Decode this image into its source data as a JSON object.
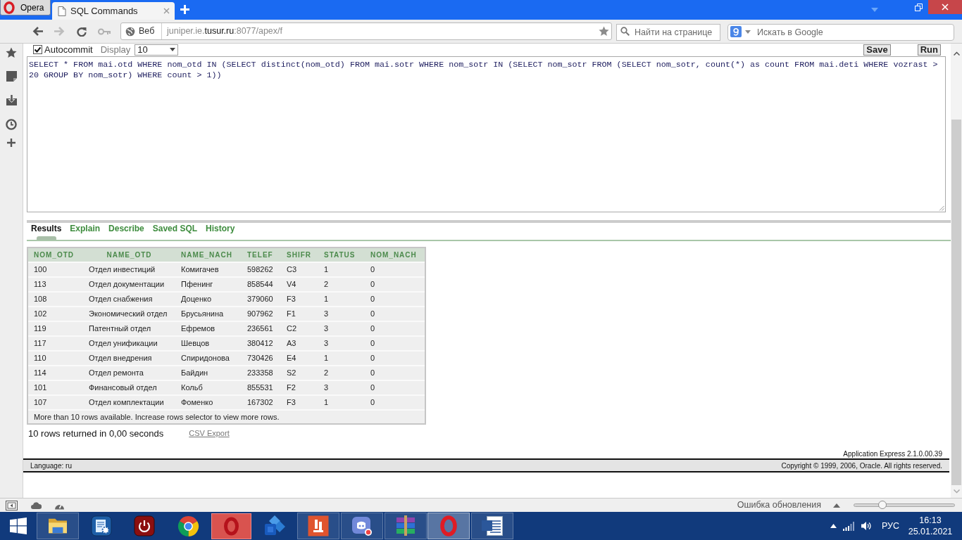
{
  "browser": {
    "menu_button": "Opera",
    "tabs": [
      {
        "title": "SQL Commands",
        "selected": true
      }
    ],
    "navigation": {
      "back": {
        "disabled": false
      },
      "forward": {
        "disabled": true
      }
    },
    "address_bar": {
      "badge": "Веб",
      "url": {
        "subdomain": "juniper.ie.",
        "domain": "tusur.ru",
        "path": ":8077/apex/f"
      }
    },
    "find_field": {
      "placeholder": "Найти на странице"
    },
    "search_field": {
      "placeholder": "Искать в Google"
    }
  },
  "sql_workshop": {
    "autocommit": {
      "label": "Autocommit",
      "checked": true
    },
    "display": {
      "label": "Display",
      "value": "10"
    },
    "buttons": [
      "Save",
      "Run"
    ],
    "query": "SELECT * FROM mai.otd WHERE nom_otd IN (SELECT distinct(nom_otd) FROM mai.sotr WHERE nom_sotr IN (SELECT nom_sotr FROM (SELECT nom_sotr, count(*) as count FROM mai.deti WHERE vozrast > 20 GROUP BY nom_sotr) WHERE count > 1))",
    "tabs": [
      {
        "label": "Results",
        "selected": true
      },
      {
        "label": "Explain",
        "selected": false
      },
      {
        "label": "Describe",
        "selected": false
      },
      {
        "label": "Saved SQL",
        "selected": false
      },
      {
        "label": "History",
        "selected": false
      }
    ],
    "results": {
      "columns": [
        "NOM_OTD",
        "NAME_OTD",
        "NAME_NACH",
        "TELEF",
        "SHIFR",
        "STATUS",
        "NOM_NACH"
      ],
      "rows": [
        [
          "100",
          "Отдел инвестиций",
          "Комигачев",
          "598262",
          "C3",
          "1",
          "0"
        ],
        [
          "113",
          "Отдел документации",
          "Пфенинг",
          "858544",
          "V4",
          "2",
          "0"
        ],
        [
          "108",
          "Отдел снабжения",
          "Доценко",
          "379060",
          "F3",
          "1",
          "0"
        ],
        [
          "102",
          "Экономический отдел",
          "Брусьянина",
          "907962",
          "F1",
          "3",
          "0"
        ],
        [
          "119",
          "Патентный отдел",
          "Ефремов",
          "236561",
          "C2",
          "3",
          "0"
        ],
        [
          "117",
          "Отдел унификации",
          "Шевцов",
          "380412",
          "A3",
          "3",
          "0"
        ],
        [
          "110",
          "Отдел внедрения",
          "Спиридонова",
          "730426",
          "E4",
          "1",
          "0"
        ],
        [
          "114",
          "Отдел ремонта",
          "Байдин",
          "233358",
          "S2",
          "2",
          "0"
        ],
        [
          "101",
          "Финансовый отдел",
          "Кольб",
          "855531",
          "F2",
          "3",
          "0"
        ],
        [
          "107",
          "Отдел комплектации",
          "Фоменко",
          "167302",
          "F3",
          "1",
          "0"
        ]
      ],
      "note": "More than 10 rows available. Increase rows selector to view more rows."
    },
    "summary": "10 rows returned in 0,00 seconds",
    "export_link": "CSV Export",
    "version": "Application Express 2.1.0.00.39",
    "footer": {
      "language": "Language: ru",
      "copyright": "Copyright © 1999, 2006, Oracle. All rights reserved."
    }
  },
  "status_bar": {
    "message": "Ошибка обновления",
    "zoom_slider": {
      "level": 0.28
    }
  },
  "taskbar": {
    "apps": [
      {
        "kind": "folder",
        "open": true,
        "selected": false
      },
      {
        "kind": "gear_document",
        "open": false,
        "selected": false
      },
      {
        "kind": "power",
        "open": false,
        "selected": false
      },
      {
        "kind": "circle_logo",
        "open": false,
        "selected": false
      },
      {
        "kind": "ring_tile",
        "open": false,
        "selected": false
      },
      {
        "kind": "diamond_blocks",
        "open": false,
        "selected": false
      },
      {
        "kind": "bars_tile",
        "open": true,
        "selected": false
      },
      {
        "kind": "chat_bubble",
        "open": true,
        "selected": false
      },
      {
        "kind": "book_stack",
        "open": true,
        "selected": false
      },
      {
        "kind": "ring",
        "open": true,
        "selected": true
      },
      {
        "kind": "document",
        "open": true,
        "selected": false
      }
    ],
    "tray": {
      "language": "РУС",
      "time": "16:13",
      "date": "25.01.2021"
    }
  }
}
